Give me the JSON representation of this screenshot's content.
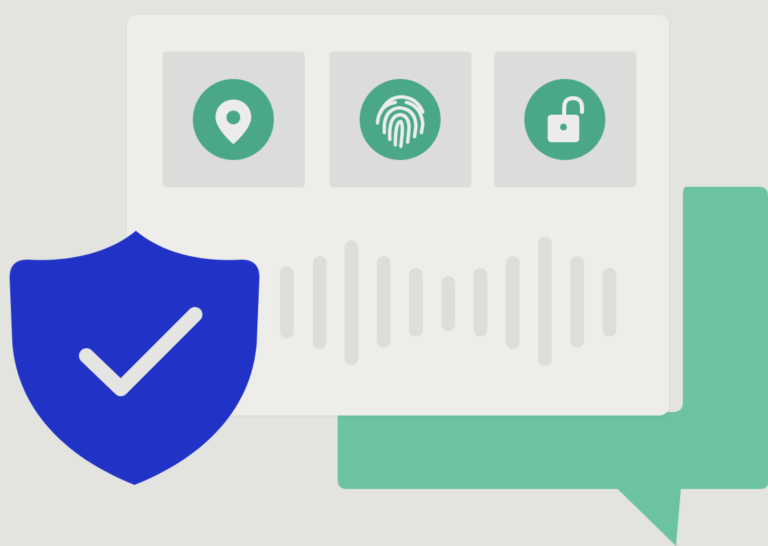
{
  "colors": {
    "background": "#e3e3e0",
    "card": "#eeedea",
    "tile": "#dcdcda",
    "accent_green": "#4aa887",
    "bubble_green": "#6cc3a0",
    "shield_blue": "#2133c7",
    "icon_light": "#ececea",
    "waveform_bar": "#dedddb"
  },
  "icons": [
    "location-pin-icon",
    "fingerprint-icon",
    "unlocked-padlock-icon",
    "shield-check-icon",
    "chat-bubble-icon"
  ]
}
